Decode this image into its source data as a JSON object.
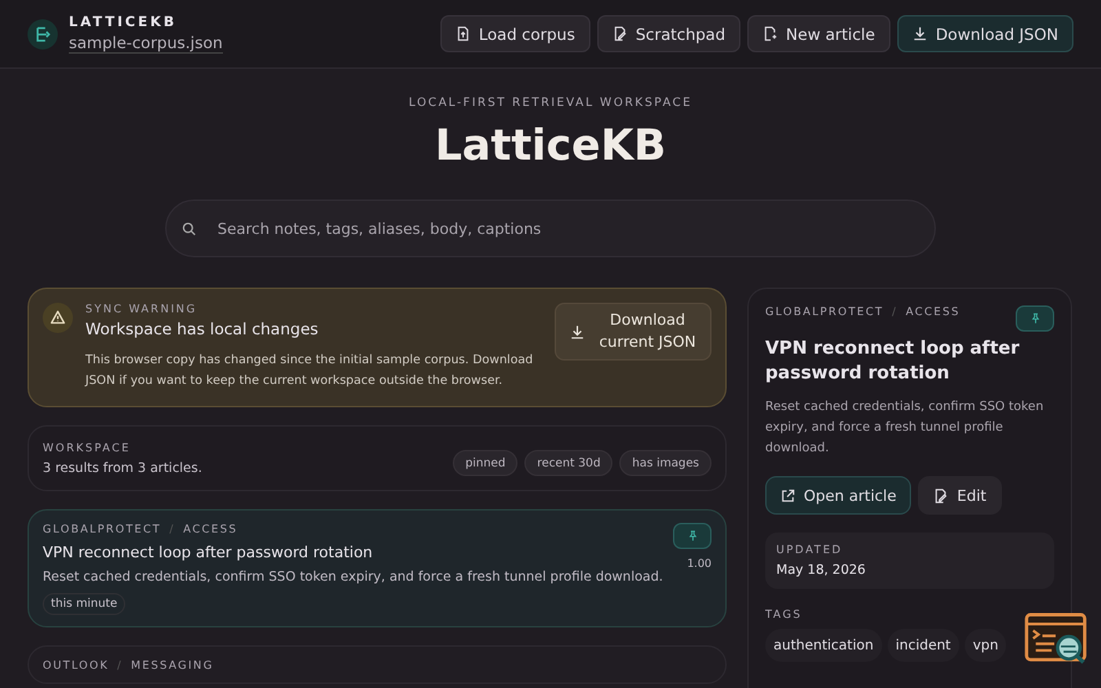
{
  "header": {
    "brand": "LATTICEKB",
    "file": "sample-corpus.json",
    "buttons": [
      {
        "label": "Load corpus",
        "kind": "load",
        "primary": false
      },
      {
        "label": "Scratchpad",
        "kind": "scratch",
        "primary": false
      },
      {
        "label": "New article",
        "kind": "new",
        "primary": false
      },
      {
        "label": "Download JSON",
        "kind": "download",
        "primary": true
      }
    ]
  },
  "hero": {
    "eyebrow": "LOCAL-FIRST RETRIEVAL WORKSPACE",
    "title": "LatticeKB"
  },
  "search": {
    "placeholder": "Search notes, tags, aliases, body, captions"
  },
  "warning": {
    "eyebrow": "SYNC WARNING",
    "title": "Workspace has local changes",
    "body": "This browser copy has changed since the initial sample corpus. Download JSON if you want to keep the current workspace outside the browser.",
    "button": "Download current JSON"
  },
  "workspace": {
    "eyebrow": "WORKSPACE",
    "summary": "3 results from 3 articles.",
    "filters": [
      "pinned",
      "recent 30d",
      "has images"
    ]
  },
  "results": [
    {
      "product": "GLOBALPROTECT",
      "separator": "/",
      "area": "ACCESS",
      "title": "VPN reconnect loop after password rotation",
      "summary": "Reset cached credentials, confirm SSO token expiry, and force a fresh tunnel profile download.",
      "score": "1.00",
      "age": "this minute",
      "pinned": true,
      "selected": true
    },
    {
      "product": "OUTLOOK",
      "separator": "/",
      "area": "MESSAGING",
      "selected": false
    }
  ],
  "detail": {
    "product": "GLOBALPROTECT",
    "separator": "/",
    "area": "ACCESS",
    "pinned": true,
    "title": "VPN reconnect loop after password rotation",
    "summary": "Reset cached credentials, confirm SSO token expiry, and force a fresh tunnel profile download.",
    "open_button": "Open article",
    "edit_button": "Edit",
    "updated_label": "UPDATED",
    "updated": "May 18, 2026",
    "tags_label": "TAGS",
    "tags": [
      "authentication",
      "incident",
      "vpn"
    ]
  }
}
